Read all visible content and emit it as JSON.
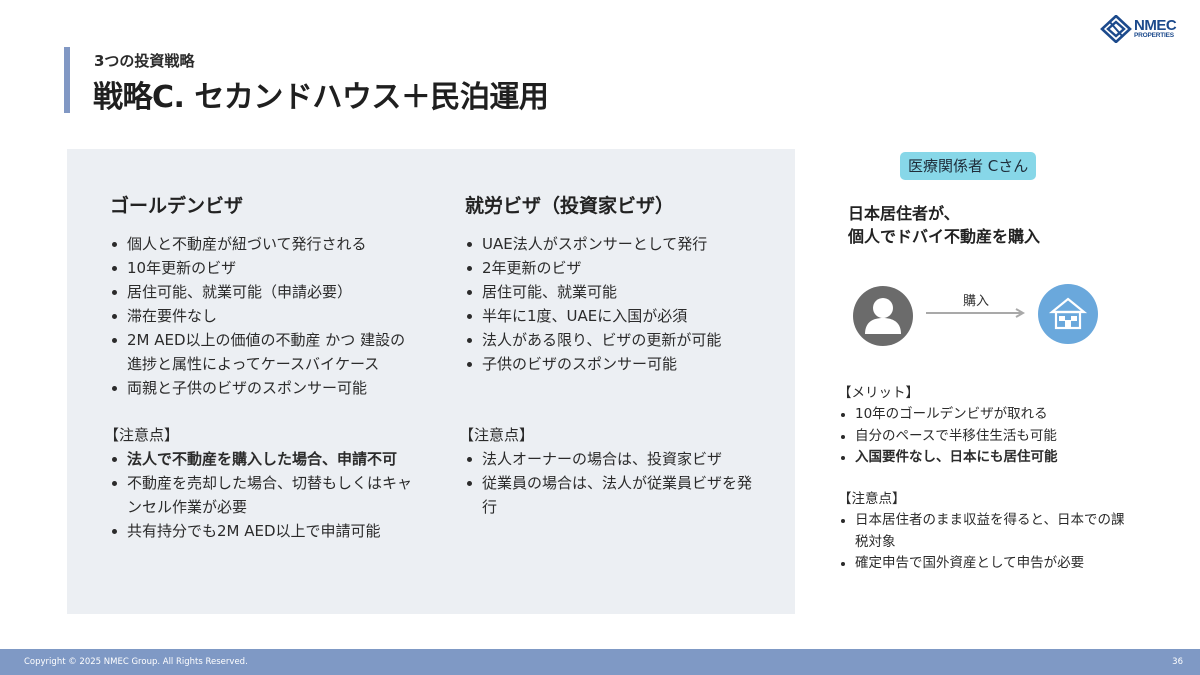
{
  "header": {
    "subtitle": "3つの投資戦略",
    "title": "戦略C. セカンドハウス＋民泊運用"
  },
  "logo": {
    "line1": "NMEC",
    "line2": "PROPERTIES",
    "icon": "diamond-logo-icon",
    "color": "#1c4a8c"
  },
  "golden": {
    "title": "ゴールデンビザ",
    "items": [
      "個人と不動産が紐づいて発行される",
      "10年更新のビザ",
      "居住可能、就業可能（申請必要）",
      "滞在要件なし",
      "2M AED以上の価値の不動産 かつ 建設の進捗と属性によってケースバイケース",
      "両親と子供のビザのスポンサー可能"
    ],
    "note_head": "【注意点】",
    "notes": [
      "法人で不動産を購入した場合、申請不可",
      "不動産を売却した場合、切替もしくはキャンセル作業が必要",
      "共有持分でも2M AED以上で申請可能"
    ]
  },
  "work": {
    "title": "就労ビザ（投資家ビザ）",
    "items": [
      "UAE法人がスポンサーとして発行",
      "2年更新のビザ",
      "居住可能、就業可能",
      "半年に1度、UAEに入国が必須",
      "法人がある限り、ビザの更新が可能",
      "子供のビザのスポンサー可能"
    ],
    "note_head": "【注意点】",
    "notes": [
      "法人オーナーの場合は、投資家ビザ",
      "従業員の場合は、法人が従業員ビザを発行"
    ]
  },
  "side": {
    "badge": "医療関係者 Cさん",
    "badge_color": "#87d7e8",
    "heading_line1": "日本居住者が、",
    "heading_line2": "個人でドバイ不動産を購入",
    "arrow_label": "購入",
    "person_icon": "person-icon",
    "house_icon": "house-icon",
    "merit_head": "【メリット】",
    "merits": [
      "10年のゴールデンビザが取れる",
      "自分のペースで半移住生活も可能",
      "入国要件なし、日本にも居住可能"
    ],
    "note_head": "【注意点】",
    "notes": [
      "日本居住者のまま収益を得ると、日本での課税対象",
      "確定申告で国外資産として申告が必要"
    ]
  },
  "footer": {
    "copyright": "Copyright © 2025 NMEC Group. All Rights Reserved.",
    "page": "36"
  }
}
